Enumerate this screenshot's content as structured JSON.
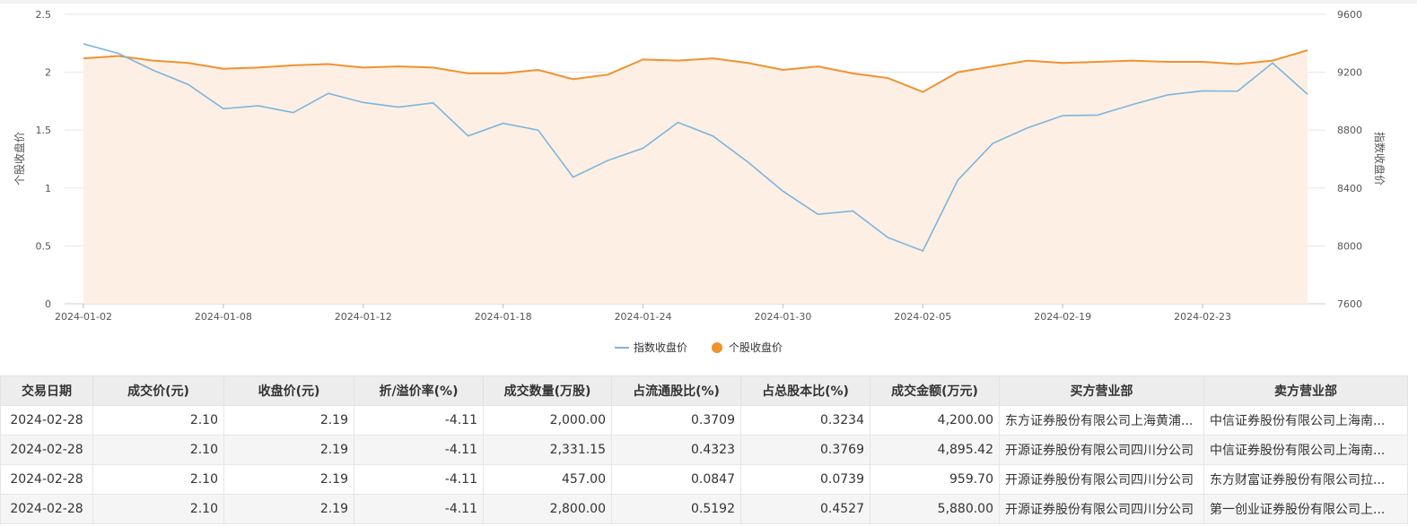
{
  "chart_data": {
    "type": "line",
    "title": "",
    "left_axis": {
      "label": "个股收盘价",
      "ylim": [
        0,
        2.5
      ],
      "ticks": [
        "0",
        "0.5",
        "1",
        "1.5",
        "2",
        "2.5"
      ]
    },
    "right_axis": {
      "label": "指数收盘价",
      "ylim": [
        7600,
        9600
      ],
      "ticks": [
        "7600",
        "8000",
        "8400",
        "8800",
        "9200",
        "9600"
      ]
    },
    "x_tick_labels": [
      "2024-01-02",
      "2024-01-08",
      "2024-01-12",
      "2024-01-18",
      "2024-01-24",
      "2024-01-30",
      "2024-02-05",
      "2024-02-19",
      "2024-02-23"
    ],
    "x_tick_indices": [
      0,
      4,
      8,
      12,
      16,
      20,
      24,
      28,
      32
    ],
    "grid": true,
    "legend_position": "bottom-center",
    "series": [
      {
        "name": "指数收盘价",
        "axis": "right",
        "color": "#7cb5de",
        "values": [
          9396,
          9330,
          9213,
          9115,
          8948,
          8968,
          8921,
          9054,
          8991,
          8959,
          8988,
          8760,
          8847,
          8800,
          8475,
          8591,
          8675,
          8853,
          8759,
          8579,
          8378,
          8218,
          8241,
          8058,
          7965,
          8454,
          8708,
          8816,
          8900,
          8904,
          8977,
          9043,
          9071,
          9069,
          9264,
          9048
        ]
      },
      {
        "name": "个股收盘价",
        "axis": "left",
        "color": "#f0922f",
        "fill": "#fdefe4",
        "values": [
          2.12,
          2.14,
          2.1,
          2.08,
          2.03,
          2.04,
          2.06,
          2.07,
          2.04,
          2.05,
          2.04,
          1.99,
          1.99,
          2.02,
          1.94,
          1.98,
          2.11,
          2.1,
          2.12,
          2.08,
          2.02,
          2.05,
          1.99,
          1.95,
          1.83,
          2.0,
          2.05,
          2.1,
          2.08,
          2.09,
          2.1,
          2.09,
          2.09,
          2.07,
          2.1,
          2.19
        ]
      }
    ]
  },
  "table": {
    "headers": [
      "交易日期",
      "成交价(元)",
      "收盘价(元)",
      "折/溢价率(%)",
      "成交数量(万股)",
      "占流通股比(%)",
      "占总股本比(%)",
      "成交金额(万元)",
      "买方营业部",
      "卖方营业部"
    ],
    "rows": [
      [
        "2024-02-28",
        "2.10",
        "2.19",
        "-4.11",
        "2,000.00",
        "0.3709",
        "0.3234",
        "4,200.00",
        "东方证券股份有限公司上海黄浦...",
        "中信证券股份有限公司上海南..."
      ],
      [
        "2024-02-28",
        "2.10",
        "2.19",
        "-4.11",
        "2,331.15",
        "0.4323",
        "0.3769",
        "4,895.42",
        "开源证券股份有限公司四川分公司",
        "中信证券股份有限公司上海南..."
      ],
      [
        "2024-02-28",
        "2.10",
        "2.19",
        "-4.11",
        "457.00",
        "0.0847",
        "0.0739",
        "959.70",
        "开源证券股份有限公司四川分公司",
        "东方财富证券股份有限公司拉..."
      ],
      [
        "2024-02-28",
        "2.10",
        "2.19",
        "-4.11",
        "2,800.00",
        "0.5192",
        "0.4527",
        "5,880.00",
        "开源证券股份有限公司四川分公司",
        "第一创业证券股份有限公司上..."
      ]
    ]
  }
}
